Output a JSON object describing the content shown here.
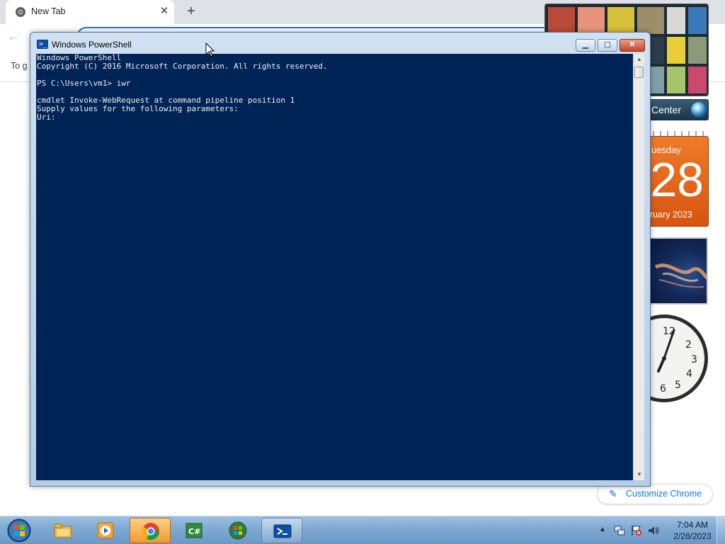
{
  "chrome": {
    "tab_title": "New Tab",
    "tab_close": "✕",
    "new_tab": "+",
    "back": "←",
    "bookmarks_text": "To g",
    "customize_icon": "✎",
    "customize_label": "Customize Chrome"
  },
  "gadgets": {
    "media_center_label": "Center",
    "calendar": {
      "day": "uesday",
      "date": "28",
      "month": "ruary 2023"
    },
    "clock_numbers": [
      "12",
      "2",
      "3",
      "4",
      "5",
      "6"
    ]
  },
  "powershell": {
    "title": "Windows PowerShell",
    "title_icon": ">_",
    "buttons": {
      "minimize": "▁",
      "maximize": "▢",
      "close": "✕"
    },
    "scroll_up": "▲",
    "scroll_down": "▼",
    "lines": [
      "Windows PowerShell",
      "Copyright (C) 2016 Microsoft Corporation. All rights reserved.",
      "",
      "PS C:\\Users\\vm1> iwr",
      "",
      "cmdlet Invoke-WebRequest at command pipeline position 1",
      "Supply values for the following parameters:",
      "Uri:"
    ],
    "colors": {
      "console_bg": "#012456",
      "console_text": "#eeedf0"
    }
  },
  "taskbar": {
    "items": [
      {
        "name": "file-explorer",
        "state": "pinned"
      },
      {
        "name": "media-player",
        "state": "pinned"
      },
      {
        "name": "chrome",
        "state": "active"
      },
      {
        "name": "csharp-app",
        "state": "pinned"
      },
      {
        "name": "media-center",
        "state": "pinned"
      },
      {
        "name": "powershell",
        "state": "open"
      }
    ],
    "tray": {
      "show_hidden": "▲",
      "time": "7:04 AM",
      "date": "2/28/2023"
    }
  }
}
